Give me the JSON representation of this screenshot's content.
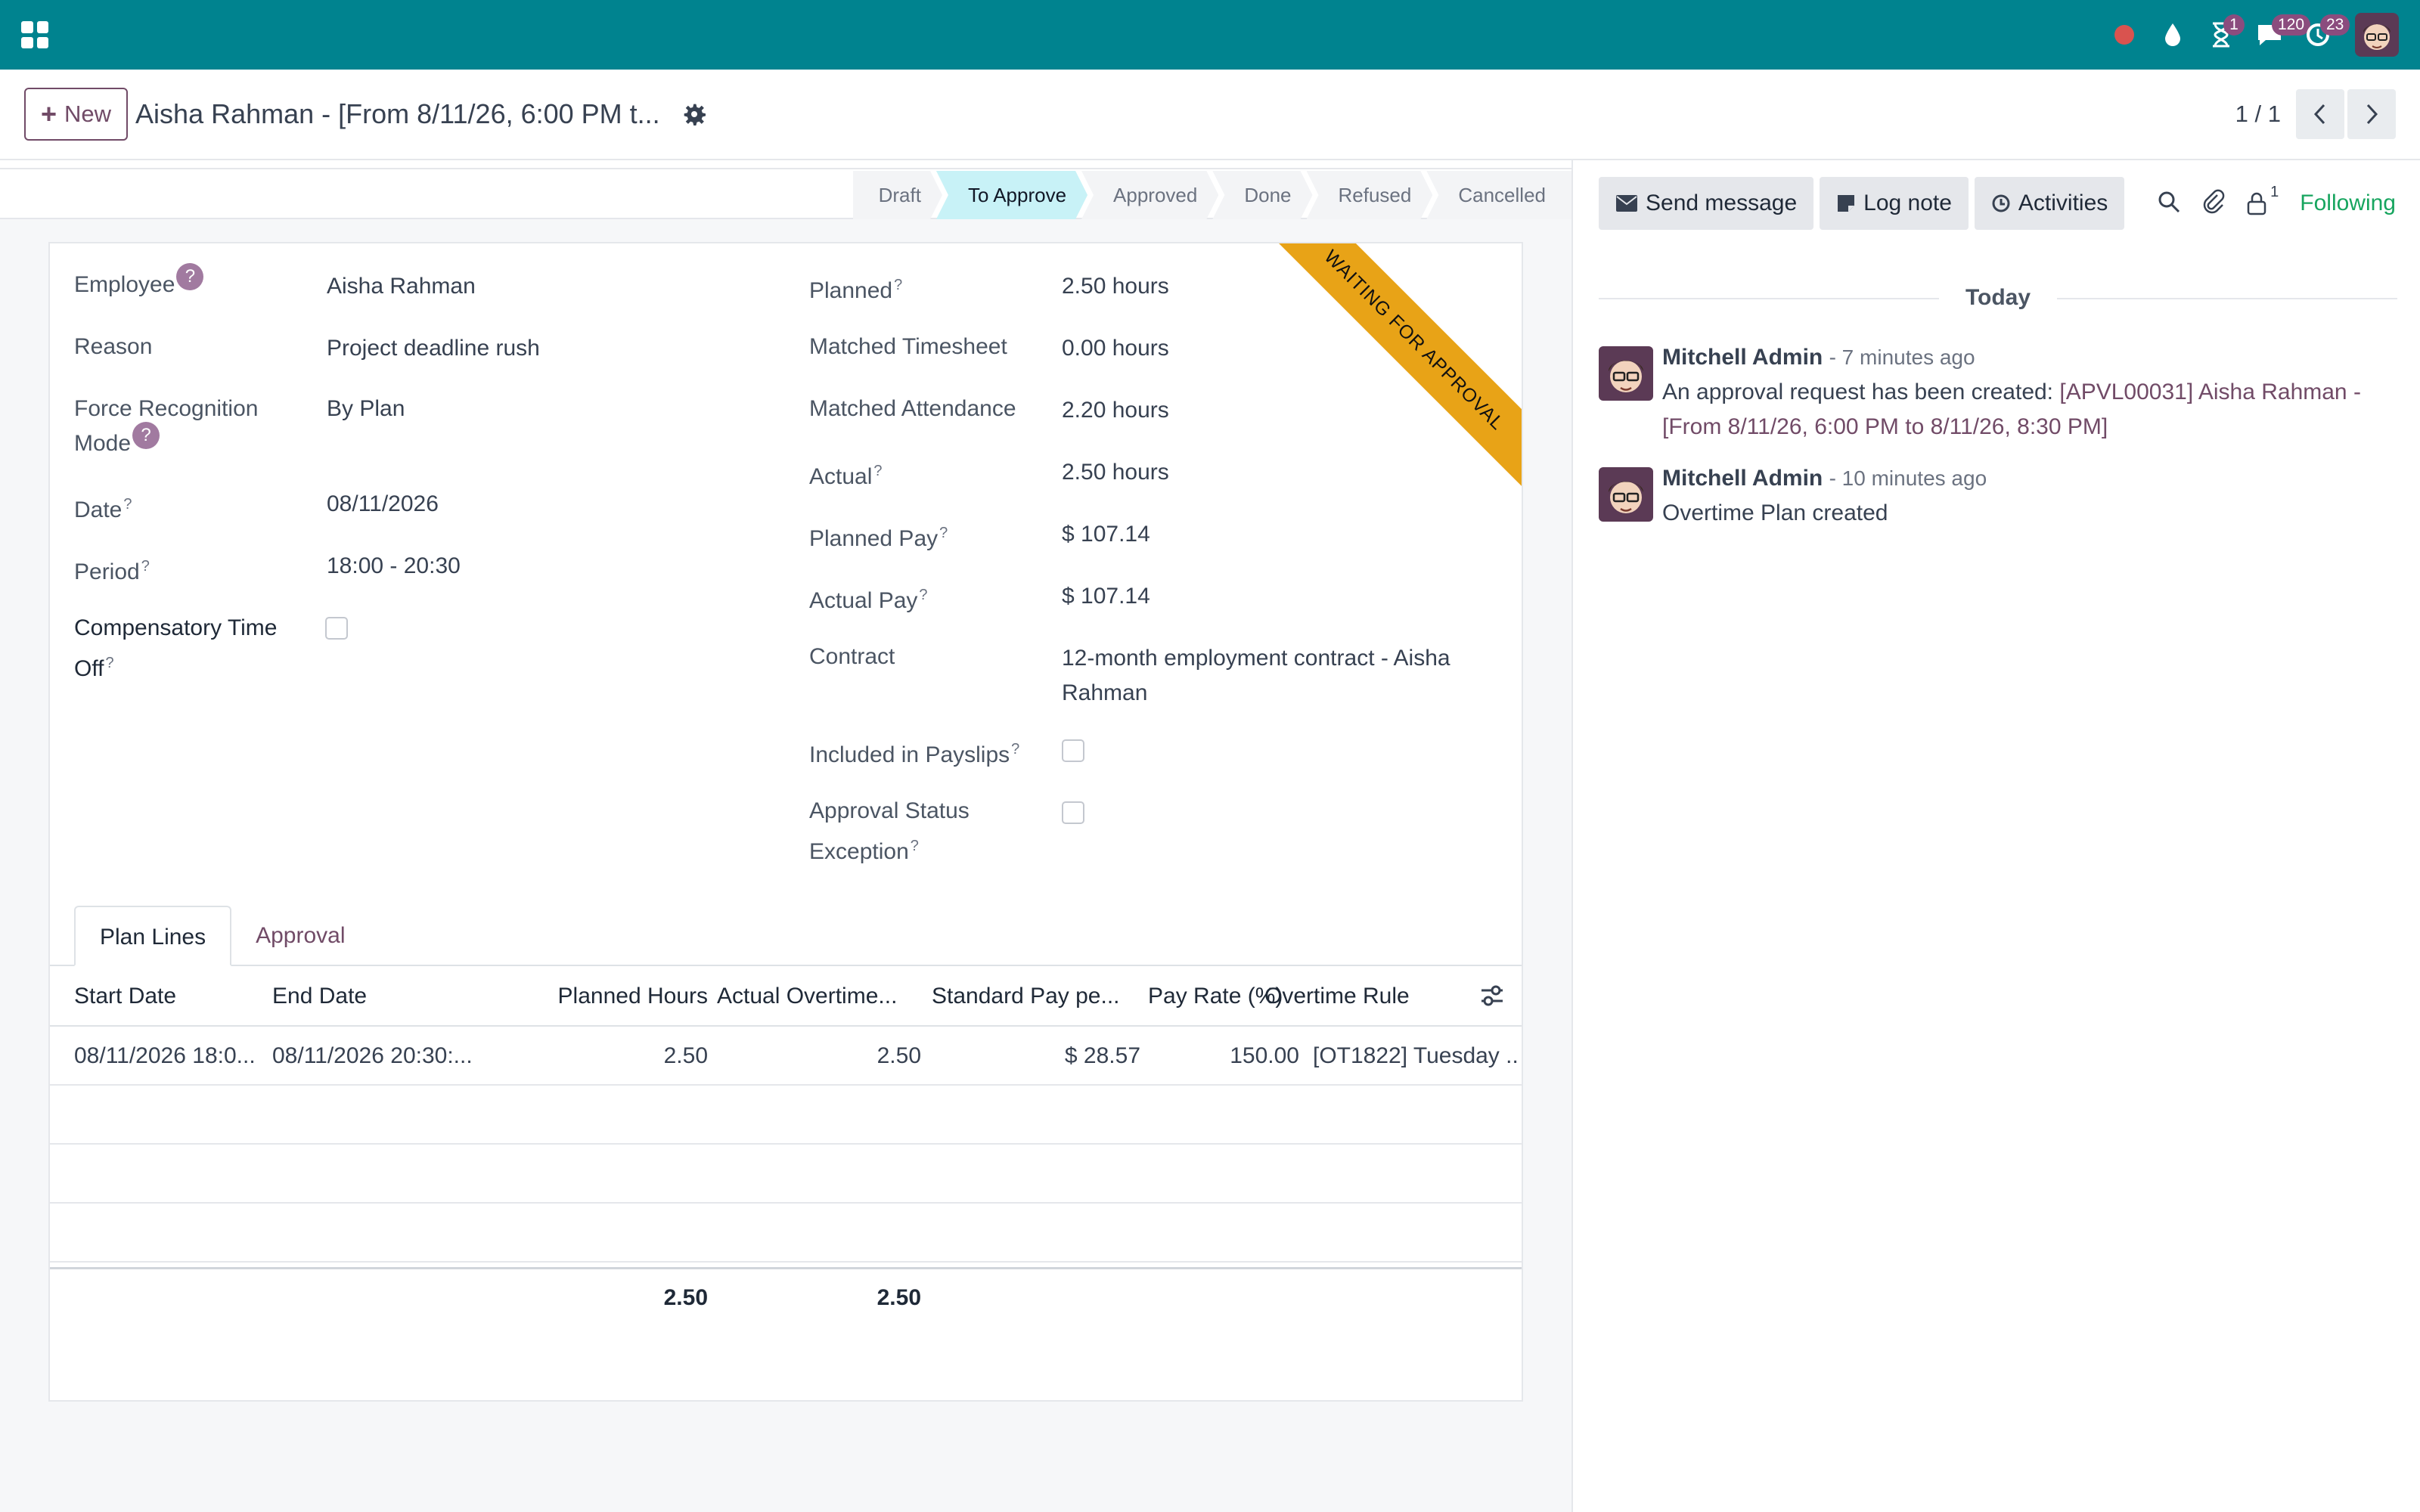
{
  "navbar": {
    "badges": {
      "activities": "1",
      "messages": "120",
      "updates": "23"
    }
  },
  "control": {
    "new_label": "New",
    "record_title": "Aisha Rahman - [From 8/11/26, 6:00 PM t...",
    "pager_value": "1 / 1"
  },
  "stages": [
    "Draft",
    "To Approve",
    "Approved",
    "Done",
    "Refused",
    "Cancelled"
  ],
  "ribbon": "WAITING FOR APPROVAL",
  "form": {
    "employee_label": "Employee",
    "employee_value": "Aisha Rahman",
    "reason_label": "Reason",
    "reason_value": "Project deadline rush",
    "force_label": "Force Recognition Mode",
    "force_value": "By Plan",
    "date_label": "Date",
    "date_value": "08/11/2026",
    "period_label": "Period",
    "period_value": "18:00 - 20:30",
    "comp_label": "Compensatory Time Off",
    "planned_label": "Planned",
    "planned_value": "2.50 hours",
    "matched_ts_label": "Matched Timesheet",
    "matched_ts_value": "0.00 hours",
    "matched_att_label": "Matched Attendance",
    "matched_att_value": "2.20 hours",
    "actual_label": "Actual",
    "actual_value": "2.50 hours",
    "planned_pay_label": "Planned Pay",
    "planned_pay_value": "$ 107.14",
    "actual_pay_label": "Actual Pay",
    "actual_pay_value": "$ 107.14",
    "contract_label": "Contract",
    "contract_value": "12-month employment contract - Aisha Rahman",
    "payslips_label": "Included in Payslips",
    "approval_exc_label": "Approval Status Exception"
  },
  "tabs": [
    "Plan Lines",
    "Approval"
  ],
  "table": {
    "headers": [
      "Start Date",
      "End Date",
      "Planned Hours",
      "Actual Overtime...",
      "Standard Pay pe...",
      "Pay Rate (%)",
      "Overtime Rule"
    ],
    "rows": [
      [
        "08/11/2026 18:0...",
        "08/11/2026 20:30:...",
        "2.50",
        "2.50",
        "$ 28.57",
        "150.00",
        "[OT1822] Tuesday ..."
      ]
    ],
    "totals": {
      "planned_hours": "2.50",
      "actual_overtime": "2.50"
    }
  },
  "chatter": {
    "send_message": "Send message",
    "log_note": "Log note",
    "activities": "Activities",
    "followers_count": "1",
    "following": "Following",
    "today": "Today",
    "messages": [
      {
        "author": "Mitchell Admin",
        "time": "- 7 minutes ago",
        "text": "An approval request has been created: ",
        "link": "[APVL00031] Aisha Rahman - [From 8/11/26, 6:00 PM to 8/11/26, 8:30 PM]"
      },
      {
        "author": "Mitchell Admin",
        "time": "- 10 minutes ago",
        "text": "Overtime Plan created"
      }
    ]
  }
}
